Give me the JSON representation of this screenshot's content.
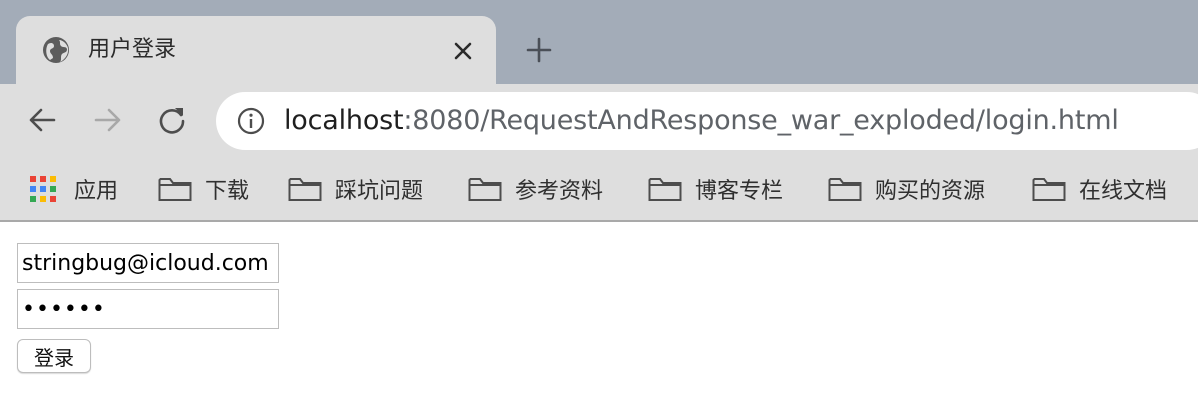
{
  "tab": {
    "title": "用户登录",
    "favicon": "globe-icon"
  },
  "toolbar": {
    "url_host": "localhost",
    "url_rest": ":8080/RequestAndResponse_war_exploded/login.html"
  },
  "bookmarks": [
    {
      "label": "应用",
      "icon": "apps-grid-icon"
    },
    {
      "label": "下载",
      "icon": "folder-icon"
    },
    {
      "label": "踩坑问题",
      "icon": "folder-icon"
    },
    {
      "label": "参考资料",
      "icon": "folder-icon"
    },
    {
      "label": "博客专栏",
      "icon": "folder-icon"
    },
    {
      "label": "购买的资源",
      "icon": "folder-icon"
    },
    {
      "label": "在线文档",
      "icon": "folder-icon"
    }
  ],
  "form": {
    "email_value": "stringbug@icloud.com",
    "password_value": "••••••",
    "login_label": "登录"
  },
  "colors": {
    "tabstrip": "#a3acb8",
    "chrome": "#dedede",
    "omnibox": "#ffffff",
    "apps_red": "#ea4335",
    "apps_blue": "#4285f4",
    "apps_yellow": "#fbbc05",
    "apps_green": "#34a853"
  }
}
